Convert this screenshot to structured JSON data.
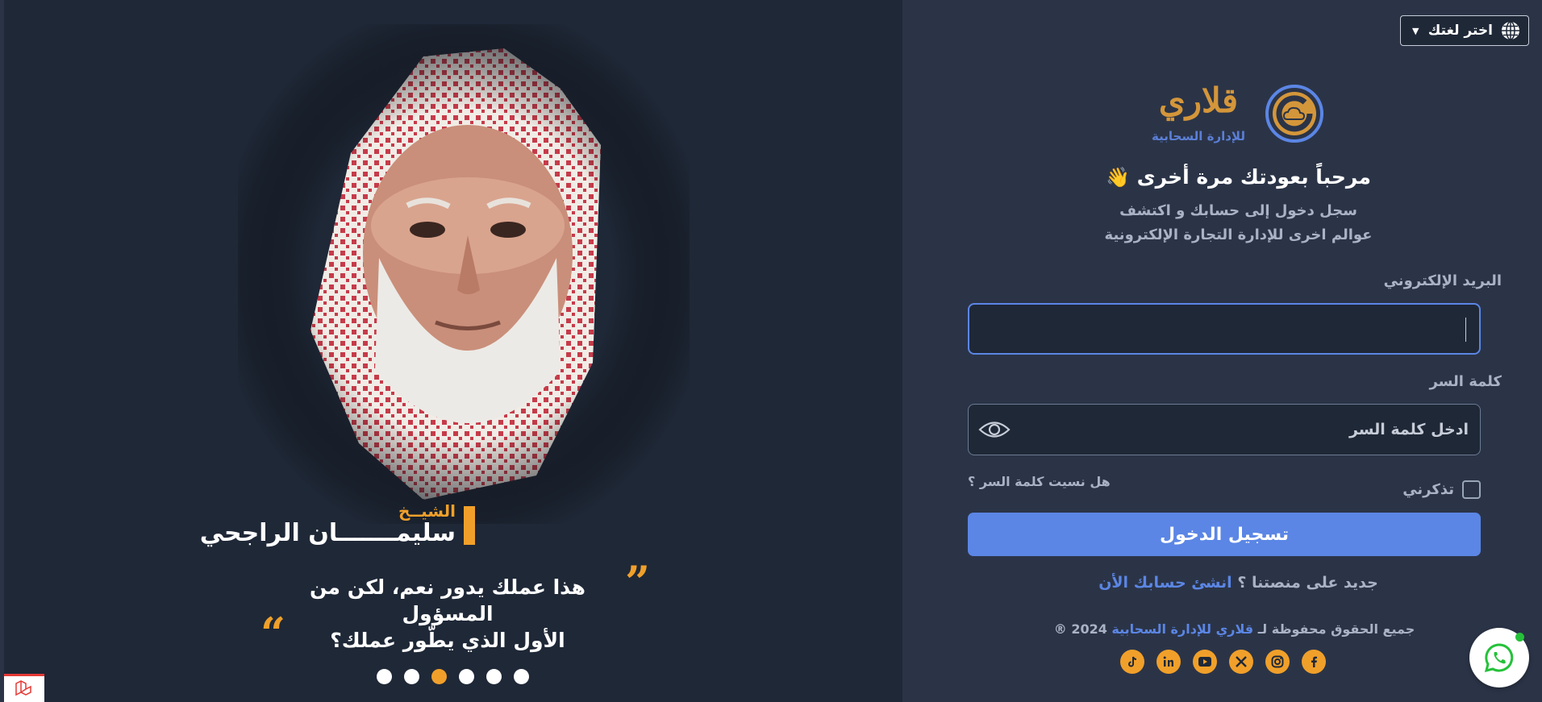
{
  "language": {
    "label": "اختر لغتك",
    "icon": "globe-icon"
  },
  "logo": {
    "name": "قلاري",
    "tagline": "للإدارة السحابية",
    "icon": "cloud-logo-mark"
  },
  "welcome": {
    "title": "مرحباً بعودتك مرة أخرى",
    "emoji": "👋",
    "subtitle_line1": "سجل دخول إلى حسابك و اكتشف",
    "subtitle_line2": "عوالم اخرى للإدارة التجارة الإلكترونية"
  },
  "form": {
    "email_label": "البريد الإلكتروني",
    "email_value": "",
    "password_label": "كلمة السر",
    "password_placeholder": "ادخل كلمة السر",
    "remember_label": "تذكرني",
    "forgot_label": "هل نسيت كلمة السر ؟",
    "submit_label": "تسجيل الدخول"
  },
  "signup": {
    "text": "جديد على منصتنا ؟",
    "link": "انشئ حسابك الأن"
  },
  "footer": {
    "copyright_prefix": "جميع الحقوق محفوظة لـ",
    "brand": "قلاري للإدارة السحابية",
    "year": "2024 ®"
  },
  "socials": [
    "tiktok-icon",
    "linkedin-icon",
    "youtube-icon",
    "x-icon",
    "instagram-icon",
    "facebook-icon"
  ],
  "hero": {
    "person_title": "الشيــخ",
    "person_name": "سليمـــــــان الراجحي",
    "quote_line1": "هذا عملك يدور نعم، لكن من المسؤول",
    "quote_line2": "الأول الذي يطّور عملك؟",
    "open_quote": "”",
    "close_quote": "“",
    "active_slide": 3,
    "slide_count": 6
  },
  "colors": {
    "accent": "#5b86e5",
    "gold": "#f0a02a",
    "panel": "#2b3447",
    "hero_bg": "#1f2837"
  }
}
